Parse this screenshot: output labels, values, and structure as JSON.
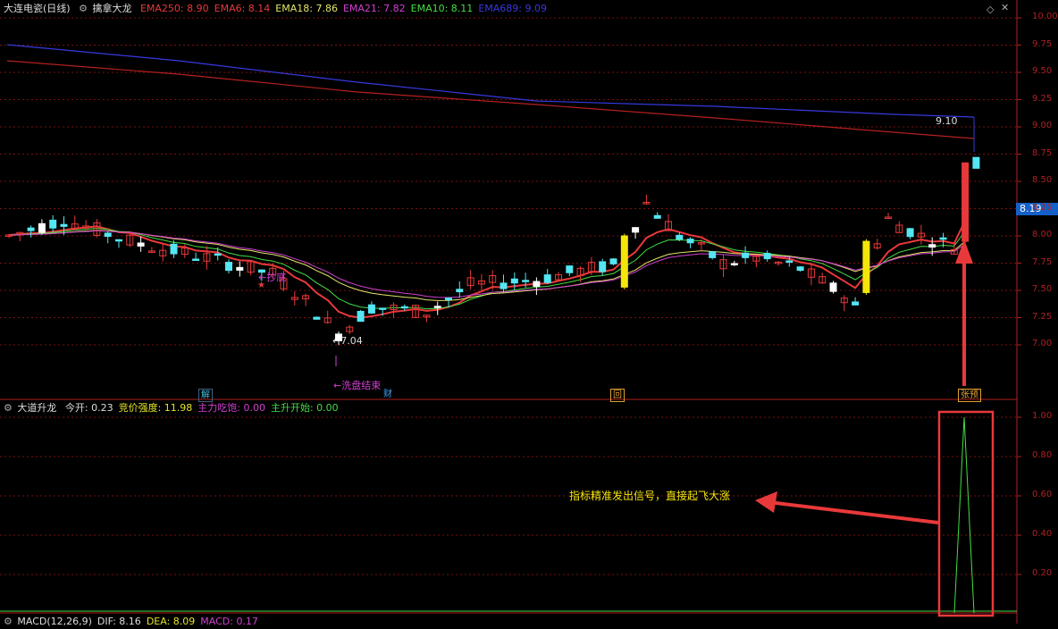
{
  "main_header": {
    "stock": "大连电瓷(日线)",
    "indicator": "擒拿大龙",
    "ema_items": [
      {
        "label": "EMA250: 8.90",
        "color": "#e8393a"
      },
      {
        "label": "EMA6: 8.14",
        "color": "#e8393a"
      },
      {
        "label": "EMA18: 7.86",
        "color": "#e4e46a"
      },
      {
        "label": "EMA21: 7.82",
        "color": "#d040d0"
      },
      {
        "label": "EMA10: 8.11",
        "color": "#44dd44"
      },
      {
        "label": "EMA689: 9.09",
        "color": "#3838e0"
      }
    ]
  },
  "sub_header": {
    "name": "大道升龙",
    "items": [
      {
        "label": "今开: 0.23",
        "color": "#dddddd"
      },
      {
        "label": "竞价强度: 11.98",
        "color": "#e4e42a"
      },
      {
        "label": "主力吃饱: 0.00",
        "color": "#d040d0"
      },
      {
        "label": "主升开始: 0.00",
        "color": "#44dd44"
      }
    ]
  },
  "bottom_header": {
    "items": [
      {
        "label": "MACD(12,26,9)",
        "color": "#dddddd"
      },
      {
        "label": "DIF: 8.16",
        "color": "#dddddd"
      },
      {
        "label": "DEA: 8.09",
        "color": "#e4e42a"
      },
      {
        "label": "MACD: 0.17",
        "color": "#d040d0"
      }
    ]
  },
  "current_price": "8.19",
  "price_axis": {
    "min": 6.8,
    "max": 10.0,
    "ticks": [
      "10.00",
      "9.75",
      "9.50",
      "9.25",
      "9.00",
      "8.75",
      "8.50",
      "8.25",
      "8.00",
      "7.75",
      "7.50",
      "7.25",
      "7.00"
    ]
  },
  "sub_axis": {
    "ticks": [
      "1.00",
      "0.80",
      "0.60",
      "0.40",
      "0.20"
    ]
  },
  "event_tags": [
    {
      "text": "解",
      "color": "#40c0e0"
    },
    {
      "text": "财",
      "color": "#40a0f0"
    },
    {
      "text": "回",
      "color": "#e0a030"
    },
    {
      "text": "张预",
      "color": "#e0a030"
    }
  ],
  "annotations": {
    "low_price": "←7.04",
    "high_price": "9.10",
    "bottom_label": "←抄底",
    "wash_end": "←洗盘结束",
    "signal_text": "指标精准发出信号，直接起飞大涨"
  },
  "chart_data": {
    "type": "candlestick",
    "ema_last": {
      "EMA250": 8.9,
      "EMA6": 8.14,
      "EMA18": 7.86,
      "EMA21": 7.82,
      "EMA10": 8.11,
      "EMA689": 9.09
    },
    "low": 7.04,
    "high": 9.1,
    "last": 8.19,
    "signal_value": 1.0
  },
  "colors": {
    "up": "#e8393a",
    "down": "#54e6f2",
    "flat": "#ffffff",
    "highlight": "#f5e60a",
    "axis": "#b02020",
    "grid": "#7a1010"
  }
}
